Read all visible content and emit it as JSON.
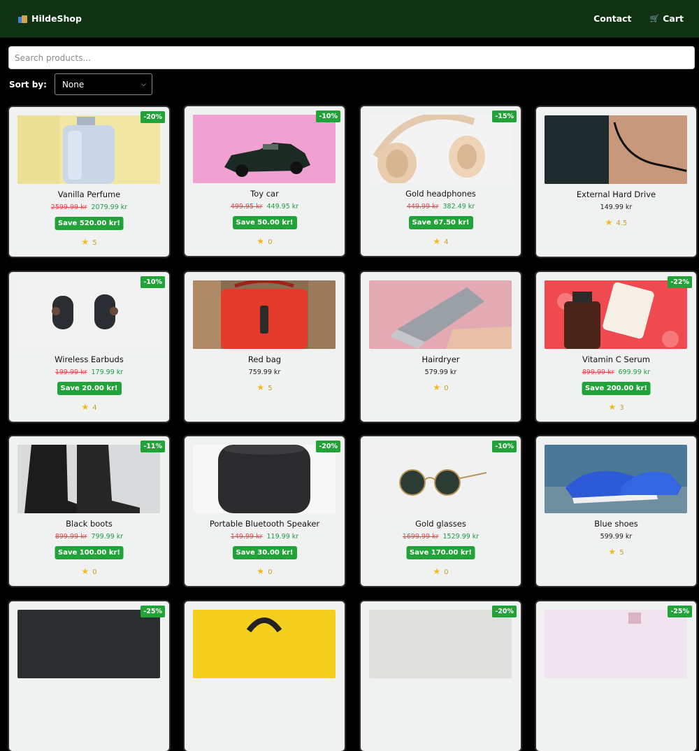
{
  "navbar": {
    "brand": "HildeShop",
    "contact": "Contact",
    "cart": "Cart"
  },
  "search": {
    "placeholder": "Search products...",
    "value": ""
  },
  "sort": {
    "label": "Sort by:",
    "selected": "None"
  },
  "products": [
    {
      "name": "Vanilla Perfume",
      "badge": "-20%",
      "old_price": "2599.99 kr",
      "price": "2079.99 kr",
      "save": "Save 520.00 kr!",
      "rating": "5"
    },
    {
      "name": "Toy car",
      "badge": "-10%",
      "old_price": "499.95 kr",
      "price": "449.95 kr",
      "save": "Save 50.00 kr!",
      "rating": "0"
    },
    {
      "name": "Gold headphones",
      "badge": "-15%",
      "old_price": "449.99 kr",
      "price": "382.49 kr",
      "save": "Save 67.50 kr!",
      "rating": "4"
    },
    {
      "name": "External Hard Drive",
      "badge": "",
      "old_price": "",
      "price": "149.99 kr",
      "save": "",
      "rating": "4.5"
    },
    {
      "name": "Wireless Earbuds",
      "badge": "-10%",
      "old_price": "199.99 kr",
      "price": "179.99 kr",
      "save": "Save 20.00 kr!",
      "rating": "4"
    },
    {
      "name": "Red bag",
      "badge": "",
      "old_price": "",
      "price": "759.99 kr",
      "save": "",
      "rating": "5"
    },
    {
      "name": "Hairdryer",
      "badge": "",
      "old_price": "",
      "price": "579.99 kr",
      "save": "",
      "rating": "0"
    },
    {
      "name": "Vitamin C Serum",
      "badge": "-22%",
      "old_price": "899.99 kr",
      "price": "699.99 kr",
      "save": "Save 200.00 kr!",
      "rating": "3"
    },
    {
      "name": "Black boots",
      "badge": "-11%",
      "old_price": "899.99 kr",
      "price": "799.99 kr",
      "save": "Save 100.00 kr!",
      "rating": "0"
    },
    {
      "name": "Portable Bluetooth Speaker",
      "badge": "-20%",
      "old_price": "149.99 kr",
      "price": "119.99 kr",
      "save": "Save 30.00 kr!",
      "rating": "0"
    },
    {
      "name": "Gold glasses",
      "badge": "-10%",
      "old_price": "1699.99 kr",
      "price": "1529.99 kr",
      "save": "Save 170.00 kr!",
      "rating": "0"
    },
    {
      "name": "Blue shoes",
      "badge": "",
      "old_price": "",
      "price": "599.99 kr",
      "save": "",
      "rating": "5"
    },
    {
      "name": "",
      "badge": "-25%",
      "old_price": "",
      "price": "",
      "save": "",
      "rating": ""
    },
    {
      "name": "",
      "badge": "",
      "old_price": "",
      "price": "",
      "save": "",
      "rating": ""
    },
    {
      "name": "",
      "badge": "-20%",
      "old_price": "",
      "price": "",
      "save": "",
      "rating": ""
    },
    {
      "name": "",
      "badge": "-25%",
      "old_price": "",
      "price": "",
      "save": "",
      "rating": ""
    }
  ],
  "colors": {
    "navbar": "#0f3312",
    "badge": "#22a33a",
    "old_price": "#e2474b",
    "new_price": "#1e9b43",
    "star": "#f1b91e"
  }
}
